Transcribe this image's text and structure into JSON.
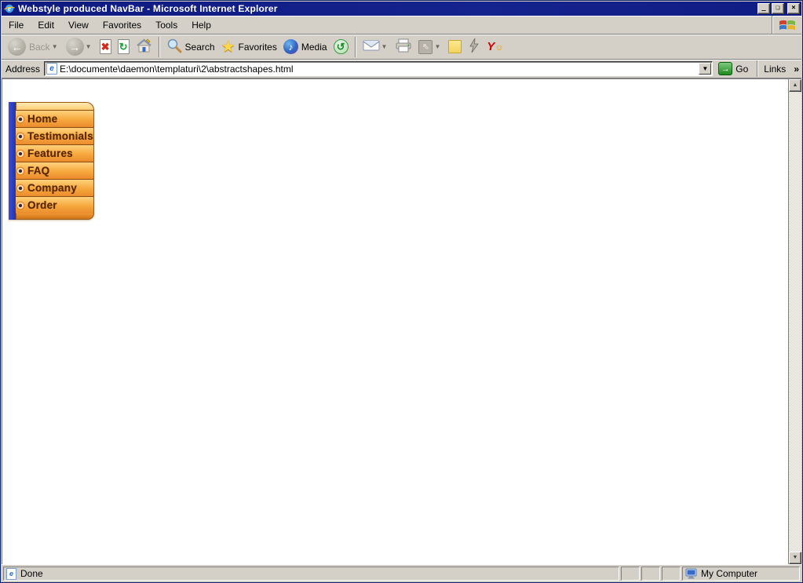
{
  "window": {
    "title": "Webstyle produced NavBar - Microsoft Internet Explorer",
    "buttons": {
      "minimize": "_",
      "restore": "❏",
      "close": "×"
    }
  },
  "menu": {
    "items": [
      "File",
      "Edit",
      "View",
      "Favorites",
      "Tools",
      "Help"
    ]
  },
  "toolbar": {
    "back_label": "Back",
    "search_label": "Search",
    "favorites_label": "Favorites",
    "media_label": "Media"
  },
  "address_bar": {
    "label": "Address",
    "value": "E:\\documente\\daemon\\templaturi\\2\\abstractshapes.html",
    "go_label": "Go",
    "links_label": "Links",
    "links_chevron": "»"
  },
  "navbar": {
    "items": [
      "Home",
      "Testimonials",
      "Features",
      "FAQ",
      "Company",
      "Order"
    ]
  },
  "status_bar": {
    "left": "Done",
    "zone": "My Computer"
  },
  "icons": {
    "back_arrow": "←",
    "forward_arrow": "→",
    "stop_x": "✖",
    "refresh": "↻",
    "history": "↺",
    "media_note": "♪",
    "dropdown": "▼",
    "scroll_up": "▲",
    "scroll_down": "▼",
    "go_arrow": "→",
    "edit_glyph": "⇖",
    "yahoo_y": "Y",
    "yahoo_smile": "☺"
  },
  "colors": {
    "titlebar_blue": "#101c84",
    "chrome_gray": "#d4d0c8",
    "nav_strip_blue": "#2b3ec2",
    "nav_orange_top": "#ffd27c",
    "nav_orange_bottom": "#ea8c2c",
    "nav_text_brown": "#5c2803",
    "go_green": "#1d8a1d"
  }
}
